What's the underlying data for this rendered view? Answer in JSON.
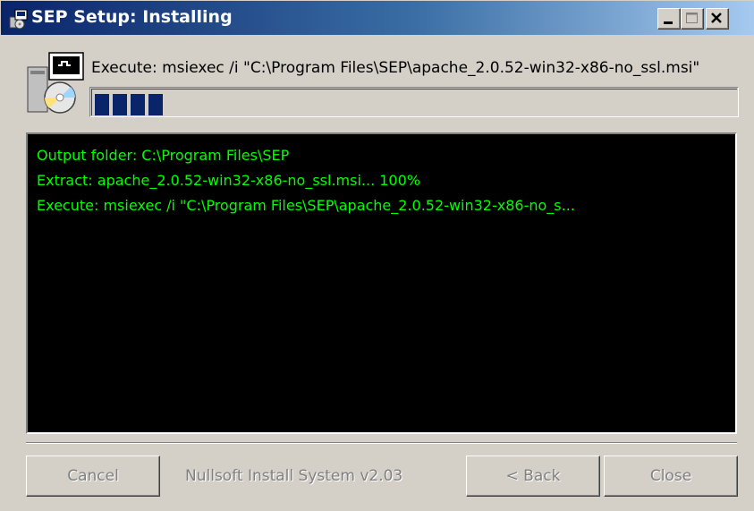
{
  "window": {
    "title": "SEP Setup: Installing",
    "icon": "installer-icon",
    "controls": {
      "minimize_icon": "minimize-icon",
      "maximize_icon": "maximize-icon",
      "close_icon": "close-icon"
    }
  },
  "header": {
    "icon": "package-cd-icon",
    "current_action": "Execute: msiexec /i \"C:\\Program Files\\SEP\\apache_2.0.52-win32-x86-no_ssl.msi\"",
    "progress_blocks": 4,
    "progress_color": "#0a246a"
  },
  "log": {
    "text_color": "#00ff00",
    "background": "#000000",
    "lines": [
      "Output folder: C:\\Program Files\\SEP",
      "Extract: apache_2.0.52-win32-x86-no_ssl.msi... 100%",
      "Execute: msiexec /i \"C:\\Program Files\\SEP\\apache_2.0.52-win32-x86-no_s..."
    ]
  },
  "footer": {
    "cancel_label": "Cancel",
    "branding": "Nullsoft Install System v2.03",
    "back_label": "< Back",
    "close_label": "Close"
  }
}
